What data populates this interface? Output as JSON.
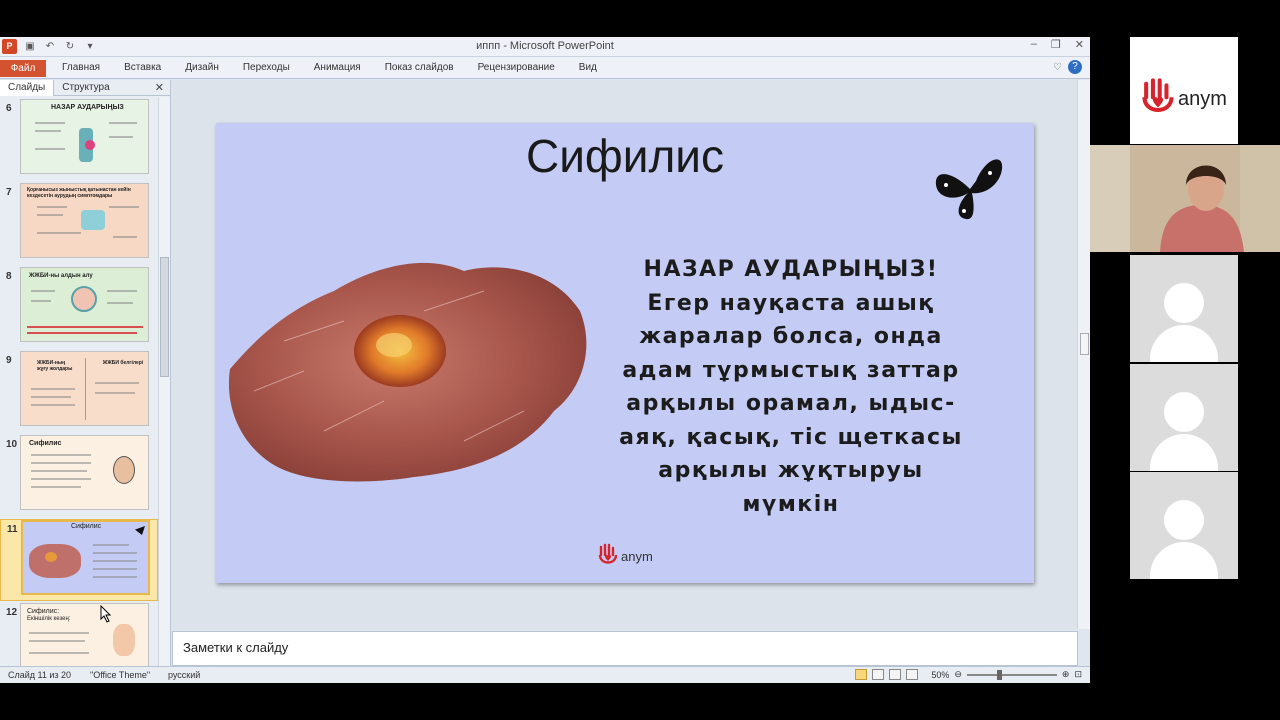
{
  "window": {
    "title": "иппп - Microsoft PowerPoint",
    "controls": [
      "–",
      "❐",
      "✕"
    ]
  },
  "ribbon": {
    "file_tab": "Файл",
    "tabs": [
      "Главная",
      "Вставка",
      "Дизайн",
      "Переходы",
      "Анимация",
      "Показ слайдов",
      "Рецензирование",
      "Вид"
    ]
  },
  "left_panel": {
    "tabs": [
      "Слайды",
      "Структура"
    ],
    "close": "✕",
    "thumbnails": [
      {
        "num": "6",
        "title": "НАЗАР АУДАРЫҢЫЗ",
        "bg": "#e7f3e5"
      },
      {
        "num": "7",
        "title": "Қорғанысыз жыныстық қатынастан кейін кездесетін аурудың симптомдары",
        "bg": "#f7d8c4"
      },
      {
        "num": "8",
        "title": "ЖЖБИ-ны алдын алу",
        "bg": "#dcefd6"
      },
      {
        "num": "9",
        "title": "ЖЖБИ-ның жұғу жолдары",
        "title2": "ЖЖБИ белгілері",
        "bg": "#f8ddca"
      },
      {
        "num": "10",
        "title": "Сифилис",
        "bg": "#fbf0e2"
      },
      {
        "num": "11",
        "title": "Сифилис",
        "bg": "#c4ccf6"
      },
      {
        "num": "12",
        "title": "Сифилис:",
        "title2": "Екіншілік кезең:",
        "bg": "#fbf0e2"
      }
    ]
  },
  "slide": {
    "title": "Сифилис",
    "heading": "НАЗАР АУДАРЫҢЫЗ!",
    "lines": [
      "Егер науқаста ашық",
      "жаралар болса, онда",
      "адам тұрмыстық заттар",
      "арқылы орамал, ыдыс-",
      "аяқ, қасық, тіс щеткасы",
      "арқылы жұқтыруы мүмкін"
    ],
    "logo_text": "anym"
  },
  "notes": {
    "placeholder": "Заметки к слайду"
  },
  "status": {
    "slide_indicator": "Слайд 11 из 20",
    "theme": "\"Office Theme\"",
    "language": "русский",
    "zoom": "50%",
    "zoom_level": 0.5
  },
  "video": {
    "logo_text": "anym"
  },
  "colors": {
    "file_tab": "#d35230",
    "slide_bg": "#c4ccf6",
    "selected_thumb": "#fbe7a8",
    "logo_red": "#d6232c"
  }
}
